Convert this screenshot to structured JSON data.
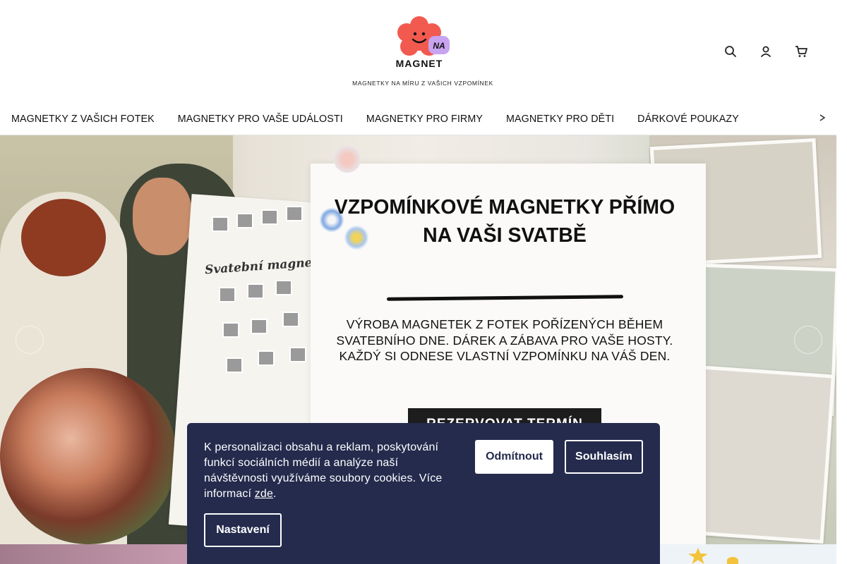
{
  "header": {
    "logo": {
      "word_na": "NA",
      "word_magnet": "MAGNET",
      "tagline": "MAGNETKY NA MÍRU Z VAŠICH VZPOMÍNEK",
      "colors": {
        "flower": "#f25a4f",
        "badge": "#c8a3f0",
        "text": "#111111"
      }
    },
    "icons": [
      "search-icon",
      "user-icon",
      "cart-icon"
    ]
  },
  "nav": {
    "items": [
      "MAGNETKY Z VAŠICH FOTEK",
      "MAGNETKY PRO VAŠE UDÁLOSTI",
      "MAGNETKY PRO FIRMY",
      "MAGNETKY PRO DĚTI",
      "DÁRKOVÉ POUKAZY"
    ]
  },
  "hero": {
    "board_title": "Svatební magnetky",
    "title": "VZPOMÍNKOVÉ MAGNETKY PŘÍMO NA VAŠI SVATBĚ",
    "text": "VÝROBA MAGNETEK Z FOTEK POŘÍZENÝCH BĚHEM SVATEBNÍHO DNE. DÁREK A ZÁBAVA PRO VAŠE HOSTY. KAŽDÝ SI ODNESE VLASTNÍ VZPOMÍNKU NA VÁŠ DEN.",
    "cta": "REZERVOVAT TERMÍN"
  },
  "cookie": {
    "text": "K personalizaci obsahu a reklam, poskytování funkcí sociálních médií a analýze naší návštěvnosti využíváme soubory cookies. Více informací",
    "link": "zde",
    "suffix": ".",
    "reject": "Odmítnout",
    "accept": "Souhlasím",
    "settings": "Nastavení",
    "colors": {
      "background": "#242b4d",
      "text": "#ffffff"
    }
  }
}
